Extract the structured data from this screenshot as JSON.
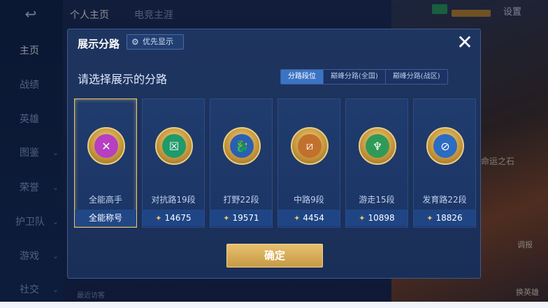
{
  "sidebar": {
    "items": [
      {
        "label": "主页",
        "active": true
      },
      {
        "label": "战绩"
      },
      {
        "label": "英雄"
      },
      {
        "label": "图鉴"
      },
      {
        "label": "荣誉"
      },
      {
        "label": "护卫队"
      },
      {
        "label": "游戏"
      },
      {
        "label": "社交"
      }
    ]
  },
  "top_tabs": [
    {
      "label": "个人主页"
    },
    {
      "label": "电竞主涯"
    }
  ],
  "settings_label": "设置",
  "background": {
    "side_text": "命运之石",
    "side_button_1": "调报",
    "side_button_2": "换英雄",
    "visitor_text": "最近访客"
  },
  "dialog": {
    "title": "展示分路",
    "priority_button": "优先显示",
    "subtitle": "请选择展示的分路",
    "segments": [
      {
        "label": "分路段位",
        "active": true
      },
      {
        "label": "巅峰分路(全国)"
      },
      {
        "label": "巅峰分路(战区)"
      }
    ],
    "cards": [
      {
        "name": "全能高手",
        "footer": "全能称号",
        "score": "",
        "selected": true,
        "emblem_color": "#b63fc2",
        "icon": "crossed-swords-icon"
      },
      {
        "name": "对抗路19段",
        "footer": "",
        "score": "14675",
        "emblem_color": "#1f9a6a",
        "icon": "shield-cross-icon"
      },
      {
        "name": "打野22段",
        "footer": "",
        "score": "19571",
        "emblem_color": "#2b5fb3",
        "icon": "dragon-icon"
      },
      {
        "name": "中路9段",
        "footer": "",
        "score": "4454",
        "emblem_color": "#c2702e",
        "icon": "slash-icon"
      },
      {
        "name": "游走15段",
        "footer": "",
        "score": "10898",
        "emblem_color": "#2f9a58",
        "icon": "wings-icon"
      },
      {
        "name": "发育路22段",
        "footer": "",
        "score": "18826",
        "emblem_color": "#2c6cc2",
        "icon": "target-icon"
      }
    ],
    "confirm_label": "确定"
  }
}
